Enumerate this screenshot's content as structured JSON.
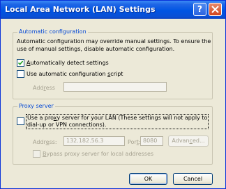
{
  "window": {
    "title": "Local Area Network (LAN) Settings"
  },
  "titlebar_buttons": {
    "help": "?"
  },
  "auto_config": {
    "legend": "Automatic configuration",
    "description_line1": "Automatic configuration may override manual settings.  To ensure the",
    "description_line2": "use of manual settings, disable automatic configuration.",
    "detect": {
      "label": "Automatically detect settings",
      "checked": true
    },
    "script": {
      "label": "Use automatic configuration script",
      "checked": false
    },
    "address_label": "Address",
    "address_value": ""
  },
  "proxy": {
    "legend": "Proxy server",
    "use_proxy_line1": "Use a proxy server for your LAN (These settings will not apply to",
    "use_proxy_line2": "dial-up or VPN connections).",
    "use_proxy_checked": false,
    "address_label": "Address:",
    "address_value": "132.182.56.3",
    "port_label": "Port:",
    "port_value": "8080",
    "advanced_label": "Advanced...",
    "bypass_label": "Bypass proxy server for local addresses",
    "bypass_checked": false
  },
  "footer": {
    "ok_label": "OK",
    "cancel_label": "Cancel"
  },
  "colors": {
    "title_bar": "#0054e3",
    "legend_text": "#0046d5",
    "dialog_bg": "#ece9d8"
  }
}
